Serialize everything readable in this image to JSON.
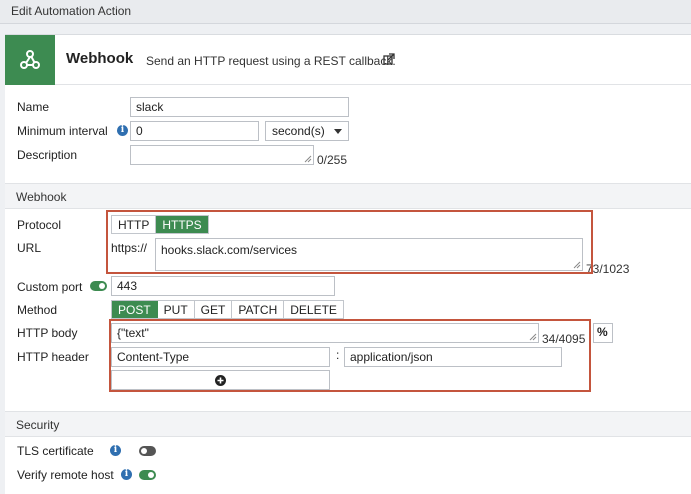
{
  "window": {
    "title": "Edit Automation Action"
  },
  "header": {
    "title": "Webhook",
    "description": "Send an HTTP request using a REST callback.",
    "icon": "webhook-icon",
    "accent": "#3d8b51"
  },
  "general": {
    "name_label": "Name",
    "name_value": "slack",
    "interval_label": "Minimum interval",
    "interval_value": "0",
    "interval_unit": "second(s)",
    "description_label": "Description",
    "description_value": "",
    "description_counter": "0/255"
  },
  "webhook": {
    "section_label": "Webhook",
    "protocol_label": "Protocol",
    "protocol_options": [
      "HTTP",
      "HTTPS"
    ],
    "protocol_selected": "HTTPS",
    "url_label": "URL",
    "url_prefix": "https://",
    "url_value": "hooks.slack.com/services",
    "url_counter": "73/1023",
    "port_label": "Custom port",
    "port_value": "443",
    "method_label": "Method",
    "method_options": [
      "POST",
      "PUT",
      "GET",
      "PATCH",
      "DELETE"
    ],
    "method_selected": "POST",
    "body_label": "HTTP body",
    "body_value": "{\"text\"",
    "body_counter": "34/4095",
    "body_percent": "%",
    "header_label": "HTTP header",
    "header_key": "Content-Type",
    "header_sep": ":",
    "header_value": "application/json"
  },
  "security": {
    "section_label": "Security",
    "tls_label": "TLS certificate",
    "verify_label": "Verify remote host"
  }
}
